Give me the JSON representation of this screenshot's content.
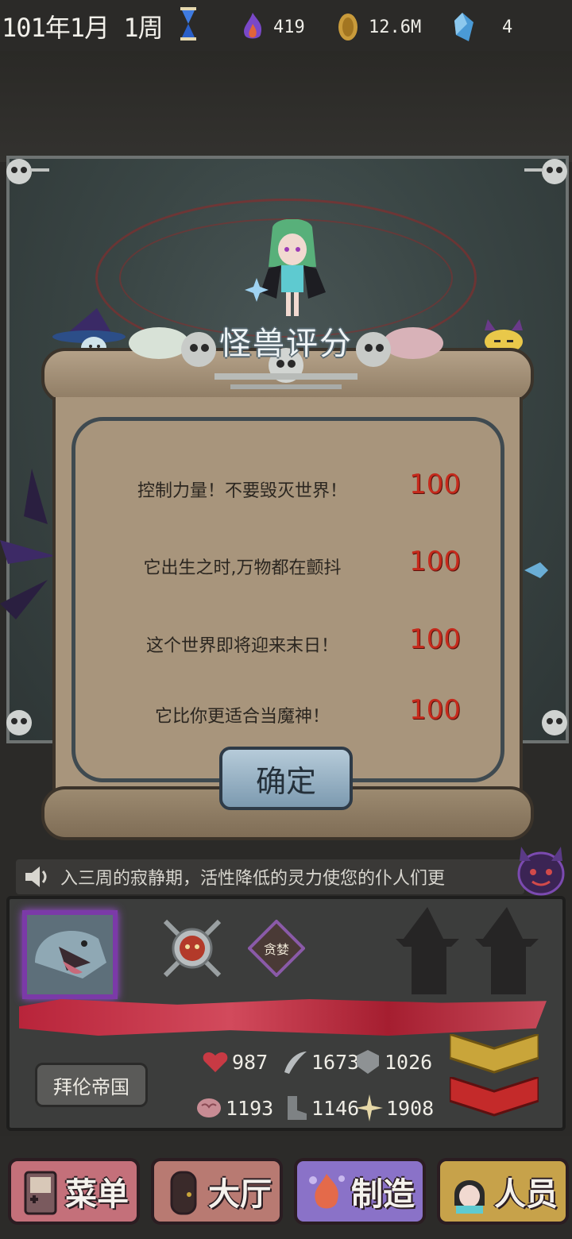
{
  "status": {
    "date": "101年1月 1周",
    "resources": [
      {
        "icon": "purple-flame-icon",
        "value": "419"
      },
      {
        "icon": "gold-coin-icon",
        "value": "12.6M"
      },
      {
        "icon": "blue-crystal-icon",
        "value": "4"
      }
    ]
  },
  "dialog": {
    "title": "怪兽评分",
    "rows": [
      {
        "text": "控制力量！不要毁灭世界！",
        "score": "100"
      },
      {
        "text": "它出生之时,万物都在颤抖",
        "score": "100"
      },
      {
        "text": "这个世界即将迎来末日！",
        "score": "100"
      },
      {
        "text": "它比你更适合当魔神！",
        "score": "100"
      }
    ],
    "confirm_label": "确定"
  },
  "ticker": {
    "text": "入三周的寂静期，活性降低的灵力使您的仆人们更"
  },
  "monster": {
    "trait_label": "贪婪",
    "kingdom": "拜伦帝国",
    "stats": [
      {
        "icon": "heart-icon",
        "value": "987"
      },
      {
        "icon": "claw-icon",
        "value": "1673"
      },
      {
        "icon": "shield-icon",
        "value": "1026"
      },
      {
        "icon": "brain-icon",
        "value": "1193"
      },
      {
        "icon": "boot-icon",
        "value": "1146"
      },
      {
        "icon": "sparkle-icon",
        "value": "1908"
      }
    ]
  },
  "nav": [
    {
      "label": "菜单",
      "icon": "handheld-menu-icon",
      "color": "#c4707a"
    },
    {
      "label": "大厅",
      "icon": "door-icon",
      "color": "#b87a72"
    },
    {
      "label": "制造",
      "icon": "magic-craft-icon",
      "color": "#8a72c8"
    },
    {
      "label": "人员",
      "icon": "girl-avatar-icon",
      "color": "#c7a24a"
    }
  ]
}
